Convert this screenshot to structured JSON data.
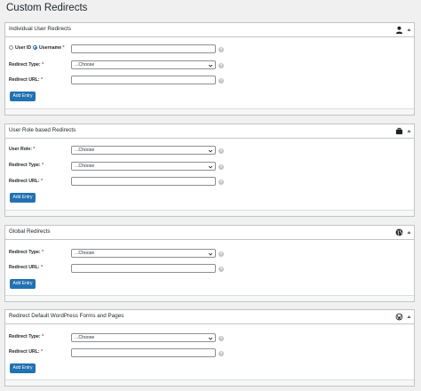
{
  "page": {
    "title": "Custom Redirects"
  },
  "common": {
    "choose": "...Choose",
    "add_entry": "Add Entry",
    "help": "?",
    "required": "*"
  },
  "individual": {
    "title": "Individual User Redirects",
    "icon": "user-icon",
    "radio_user_id": "User ID",
    "radio_username": "Username",
    "redirect_type_label": "Redirect Type:",
    "redirect_url_label": "Redirect URL:"
  },
  "role": {
    "title": "User Role based Redirects",
    "icon": "briefcase-icon",
    "user_role_label": "User Role:",
    "redirect_type_label": "Redirect Type:",
    "redirect_url_label": "Redirect URL:"
  },
  "global": {
    "title": "Global Redirects",
    "icon": "globe-icon",
    "redirect_type_label": "Redirect Type:",
    "redirect_url_label": "Redirect URL:"
  },
  "wordpress": {
    "title": "Redirect Default WordPress Forms and Pages",
    "icon": "wordpress-icon",
    "redirect_type_label": "Redirect Type:",
    "redirect_url_label": "Redirect URL:"
  },
  "colors": {
    "accent": "#2271b1",
    "required": "#d63638",
    "border": "#c3c4c7"
  }
}
